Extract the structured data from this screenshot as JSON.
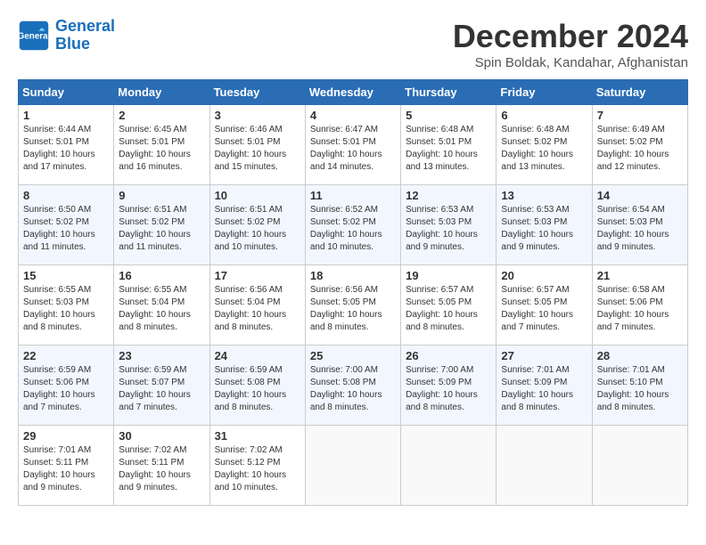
{
  "header": {
    "logo_line1": "General",
    "logo_line2": "Blue",
    "month": "December 2024",
    "location": "Spin Boldak, Kandahar, Afghanistan"
  },
  "days_of_week": [
    "Sunday",
    "Monday",
    "Tuesday",
    "Wednesday",
    "Thursday",
    "Friday",
    "Saturday"
  ],
  "weeks": [
    [
      {
        "day": "1",
        "info": "Sunrise: 6:44 AM\nSunset: 5:01 PM\nDaylight: 10 hours\nand 17 minutes."
      },
      {
        "day": "2",
        "info": "Sunrise: 6:45 AM\nSunset: 5:01 PM\nDaylight: 10 hours\nand 16 minutes."
      },
      {
        "day": "3",
        "info": "Sunrise: 6:46 AM\nSunset: 5:01 PM\nDaylight: 10 hours\nand 15 minutes."
      },
      {
        "day": "4",
        "info": "Sunrise: 6:47 AM\nSunset: 5:01 PM\nDaylight: 10 hours\nand 14 minutes."
      },
      {
        "day": "5",
        "info": "Sunrise: 6:48 AM\nSunset: 5:01 PM\nDaylight: 10 hours\nand 13 minutes."
      },
      {
        "day": "6",
        "info": "Sunrise: 6:48 AM\nSunset: 5:02 PM\nDaylight: 10 hours\nand 13 minutes."
      },
      {
        "day": "7",
        "info": "Sunrise: 6:49 AM\nSunset: 5:02 PM\nDaylight: 10 hours\nand 12 minutes."
      }
    ],
    [
      {
        "day": "8",
        "info": "Sunrise: 6:50 AM\nSunset: 5:02 PM\nDaylight: 10 hours\nand 11 minutes."
      },
      {
        "day": "9",
        "info": "Sunrise: 6:51 AM\nSunset: 5:02 PM\nDaylight: 10 hours\nand 11 minutes."
      },
      {
        "day": "10",
        "info": "Sunrise: 6:51 AM\nSunset: 5:02 PM\nDaylight: 10 hours\nand 10 minutes."
      },
      {
        "day": "11",
        "info": "Sunrise: 6:52 AM\nSunset: 5:02 PM\nDaylight: 10 hours\nand 10 minutes."
      },
      {
        "day": "12",
        "info": "Sunrise: 6:53 AM\nSunset: 5:03 PM\nDaylight: 10 hours\nand 9 minutes."
      },
      {
        "day": "13",
        "info": "Sunrise: 6:53 AM\nSunset: 5:03 PM\nDaylight: 10 hours\nand 9 minutes."
      },
      {
        "day": "14",
        "info": "Sunrise: 6:54 AM\nSunset: 5:03 PM\nDaylight: 10 hours\nand 9 minutes."
      }
    ],
    [
      {
        "day": "15",
        "info": "Sunrise: 6:55 AM\nSunset: 5:03 PM\nDaylight: 10 hours\nand 8 minutes."
      },
      {
        "day": "16",
        "info": "Sunrise: 6:55 AM\nSunset: 5:04 PM\nDaylight: 10 hours\nand 8 minutes."
      },
      {
        "day": "17",
        "info": "Sunrise: 6:56 AM\nSunset: 5:04 PM\nDaylight: 10 hours\nand 8 minutes."
      },
      {
        "day": "18",
        "info": "Sunrise: 6:56 AM\nSunset: 5:05 PM\nDaylight: 10 hours\nand 8 minutes."
      },
      {
        "day": "19",
        "info": "Sunrise: 6:57 AM\nSunset: 5:05 PM\nDaylight: 10 hours\nand 8 minutes."
      },
      {
        "day": "20",
        "info": "Sunrise: 6:57 AM\nSunset: 5:05 PM\nDaylight: 10 hours\nand 7 minutes."
      },
      {
        "day": "21",
        "info": "Sunrise: 6:58 AM\nSunset: 5:06 PM\nDaylight: 10 hours\nand 7 minutes."
      }
    ],
    [
      {
        "day": "22",
        "info": "Sunrise: 6:59 AM\nSunset: 5:06 PM\nDaylight: 10 hours\nand 7 minutes."
      },
      {
        "day": "23",
        "info": "Sunrise: 6:59 AM\nSunset: 5:07 PM\nDaylight: 10 hours\nand 7 minutes."
      },
      {
        "day": "24",
        "info": "Sunrise: 6:59 AM\nSunset: 5:08 PM\nDaylight: 10 hours\nand 8 minutes."
      },
      {
        "day": "25",
        "info": "Sunrise: 7:00 AM\nSunset: 5:08 PM\nDaylight: 10 hours\nand 8 minutes."
      },
      {
        "day": "26",
        "info": "Sunrise: 7:00 AM\nSunset: 5:09 PM\nDaylight: 10 hours\nand 8 minutes."
      },
      {
        "day": "27",
        "info": "Sunrise: 7:01 AM\nSunset: 5:09 PM\nDaylight: 10 hours\nand 8 minutes."
      },
      {
        "day": "28",
        "info": "Sunrise: 7:01 AM\nSunset: 5:10 PM\nDaylight: 10 hours\nand 8 minutes."
      }
    ],
    [
      {
        "day": "29",
        "info": "Sunrise: 7:01 AM\nSunset: 5:11 PM\nDaylight: 10 hours\nand 9 minutes."
      },
      {
        "day": "30",
        "info": "Sunrise: 7:02 AM\nSunset: 5:11 PM\nDaylight: 10 hours\nand 9 minutes."
      },
      {
        "day": "31",
        "info": "Sunrise: 7:02 AM\nSunset: 5:12 PM\nDaylight: 10 hours\nand 10 minutes."
      },
      null,
      null,
      null,
      null
    ]
  ]
}
